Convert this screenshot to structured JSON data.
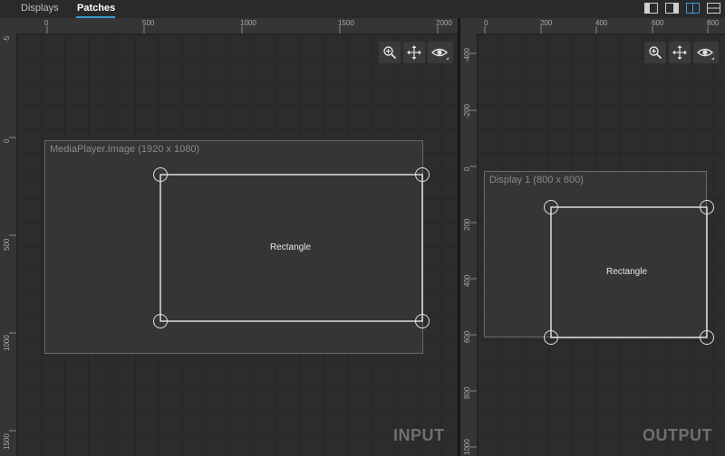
{
  "tabs": [
    {
      "label": "Displays",
      "active": false
    },
    {
      "label": "Patches",
      "active": true
    }
  ],
  "layout_buttons": [
    "layout-left-icon",
    "layout-right-icon",
    "layout-split-icon",
    "layout-stack-icon"
  ],
  "colors": {
    "accent": "#3d9ad6",
    "background": "#2c2c2c",
    "handle": "#e0e0e0"
  },
  "input": {
    "watermark": "INPUT",
    "hruler_ticks": [
      "0",
      "500",
      "1000",
      "1500",
      "2000"
    ],
    "vruler_ticks": [
      "-5",
      "0",
      "500",
      "1000",
      "1500"
    ],
    "tools": [
      "zoom-in-icon",
      "move-icon",
      "eye-icon"
    ],
    "frame_label": "MediaPlayer.Image (1920 x 1080)",
    "rect_label": "Rectangle"
  },
  "output": {
    "watermark": "OUTPUT",
    "hruler_ticks": [
      "0",
      "200",
      "400",
      "600",
      "800"
    ],
    "vruler_ticks": [
      "-400",
      "-200",
      "0",
      "200",
      "400",
      "600",
      "800",
      "1000"
    ],
    "tools": [
      "zoom-in-icon",
      "move-icon",
      "eye-icon"
    ],
    "frame_label": "Display 1 (800 x 600)",
    "rect_label": "Rectangle"
  }
}
